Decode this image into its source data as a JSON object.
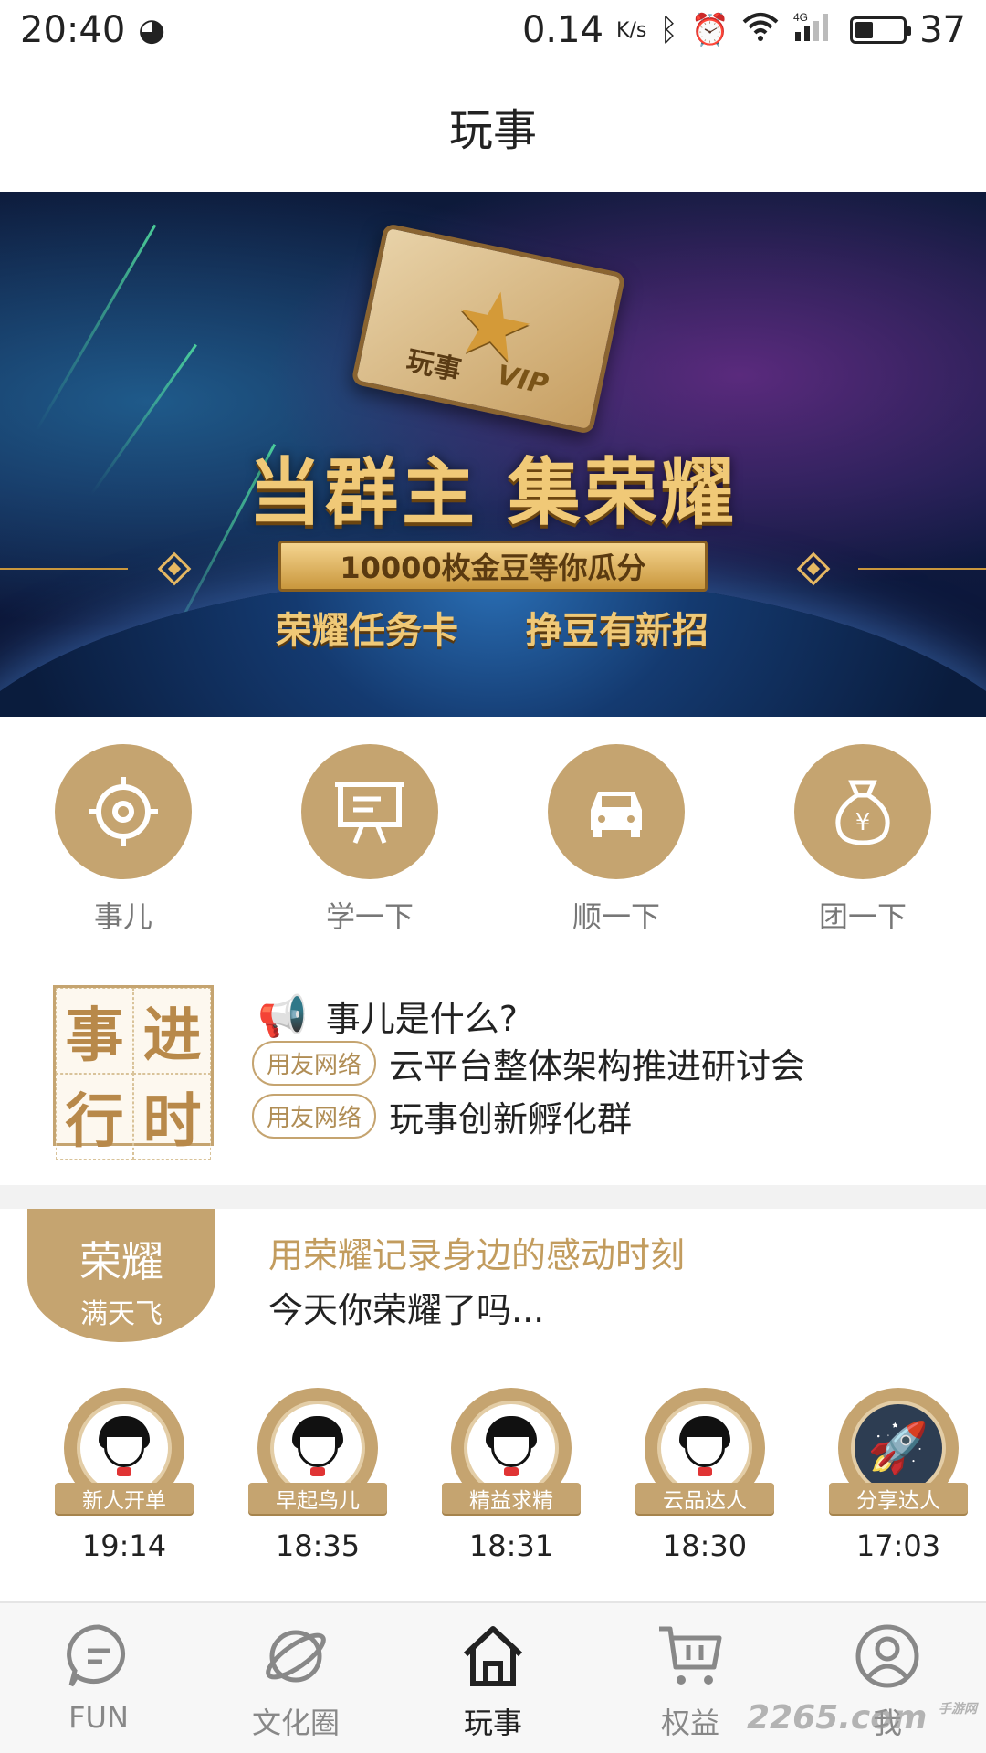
{
  "status_bar": {
    "time": "20:40",
    "network_speed": "0.14",
    "speed_unit": "K/s",
    "network_type": "4G",
    "battery": "37",
    "battery_level": 0.37
  },
  "header": {
    "title": "玩事"
  },
  "banner": {
    "card_label": "玩事",
    "card_badge": "VIP",
    "headline": "当群主  集荣耀",
    "ribbon": "10000枚金豆等你瓜分",
    "sub_left": "荣耀任务卡",
    "sub_right": "挣豆有新招"
  },
  "quick_actions": [
    {
      "label": "事儿",
      "icon": "target-icon"
    },
    {
      "label": "学一下",
      "icon": "presentation-board-icon"
    },
    {
      "label": "顺一下",
      "icon": "car-icon"
    },
    {
      "label": "团一下",
      "icon": "money-bag-icon"
    }
  ],
  "news": {
    "logo_chars": [
      "事",
      "进",
      "行",
      "时"
    ],
    "question": "事儿是什么?",
    "items": [
      {
        "tag": "用友网络",
        "title": "云平台整体架构推进研讨会"
      },
      {
        "tag": "用友网络",
        "title": "玩事创新孵化群"
      }
    ]
  },
  "honor": {
    "badge_title": "荣耀",
    "badge_sub": "满天飞",
    "headline": "用荣耀记录身边的感动时刻",
    "desc": "今天你荣耀了吗..."
  },
  "badges": [
    {
      "name": "新人开单",
      "time": "19:14",
      "icon": "cartoon-face-icon"
    },
    {
      "name": "早起鸟儿",
      "time": "18:35",
      "icon": "cartoon-face-icon"
    },
    {
      "name": "精益求精",
      "time": "18:31",
      "icon": "cartoon-face-icon"
    },
    {
      "name": "云品达人",
      "time": "18:30",
      "icon": "cartoon-face-icon"
    },
    {
      "name": "分享达人",
      "time": "17:03",
      "icon": "rocket-icon"
    }
  ],
  "bottom_nav": [
    {
      "label": "FUN",
      "icon": "chat-bubble-icon",
      "active": false
    },
    {
      "label": "文化圈",
      "icon": "planet-icon",
      "active": false
    },
    {
      "label": "玩事",
      "icon": "home-icon",
      "active": true
    },
    {
      "label": "权益",
      "icon": "cart-icon",
      "active": false
    },
    {
      "label": "我",
      "icon": "user-icon",
      "active": false
    }
  ],
  "watermark": {
    "text": "2265",
    "suffix": ".com",
    "small": "手游网"
  },
  "colors": {
    "gold": "#c5a470",
    "gold_text": "#c29c5e",
    "nav_bg": "#f7f7f7"
  }
}
